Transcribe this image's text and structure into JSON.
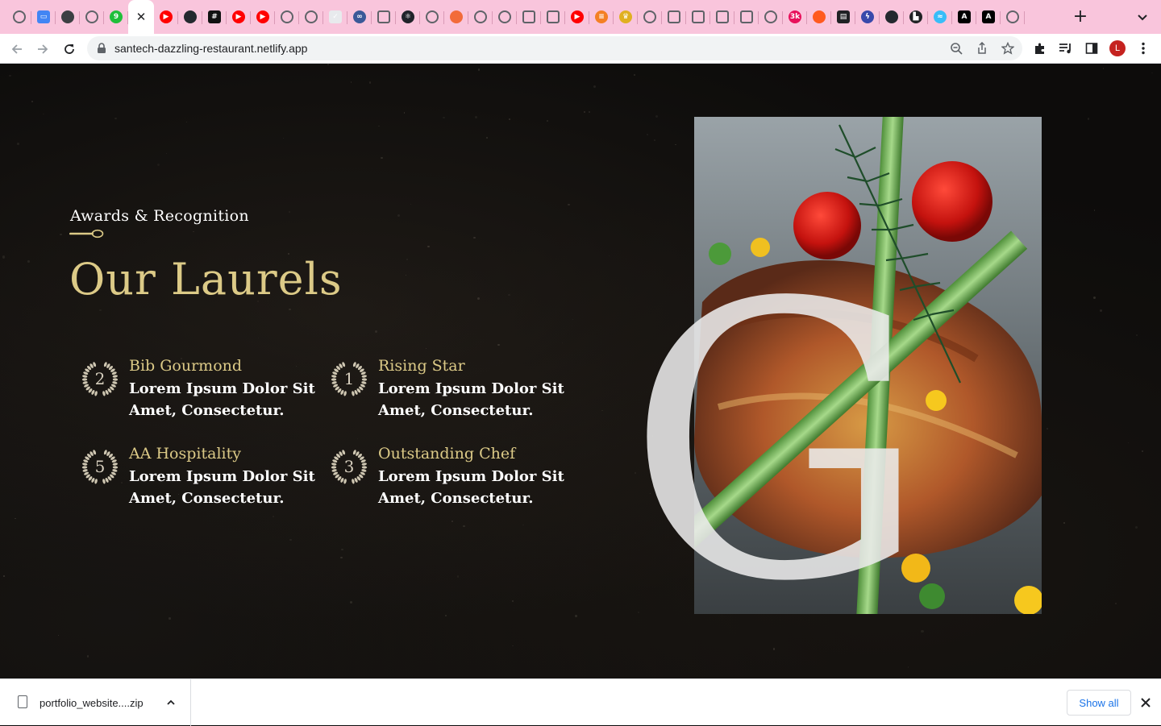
{
  "browser": {
    "tab_favicons": [
      {
        "icon": "globe-icon",
        "color": "#5f6368"
      },
      {
        "icon": "app-icon",
        "color": "#4285f4",
        "glyph": "▭"
      },
      {
        "icon": "dark-circle-icon",
        "color": "#3c4043"
      },
      {
        "icon": "globe-icon",
        "color": "#5f6368"
      },
      {
        "icon": "green-badge-icon",
        "color": "#1fbf3a",
        "glyph": "9"
      },
      {
        "icon": "diamond-icon",
        "color": "#16a3b8"
      },
      {
        "icon": "youtube-icon",
        "color": "#ff0000",
        "glyph": "▶"
      },
      {
        "icon": "github-icon",
        "color": "#24292f"
      },
      {
        "icon": "app-icon",
        "color": "#111111",
        "glyph": "#"
      },
      {
        "icon": "youtube-icon",
        "color": "#ff0000",
        "glyph": "▶"
      },
      {
        "icon": "youtube-icon",
        "color": "#ff0000",
        "glyph": "▶"
      },
      {
        "icon": "globe-icon",
        "color": "#5f6368"
      },
      {
        "icon": "globe-icon",
        "color": "#5f6368"
      },
      {
        "icon": "app-icon",
        "color": "#e8eaed",
        "glyph": "✓"
      },
      {
        "icon": "infinity-icon",
        "color": "#3b5998",
        "glyph": "∞"
      },
      {
        "icon": "square-icon",
        "color": "#5f6368"
      },
      {
        "icon": "react-icon",
        "color": "#20232a",
        "glyph": "⚛"
      },
      {
        "icon": "globe-icon",
        "color": "#5f6368"
      },
      {
        "icon": "octopus-icon",
        "color": "#f26b3a"
      },
      {
        "icon": "globe-icon",
        "color": "#5f6368"
      },
      {
        "icon": "globe-icon",
        "color": "#5f6368"
      },
      {
        "icon": "square-icon",
        "color": "#5f6368"
      },
      {
        "icon": "square-icon",
        "color": "#5f6368"
      },
      {
        "icon": "youtube-icon",
        "color": "#ff0000",
        "glyph": "▶"
      },
      {
        "icon": "stack-icon",
        "color": "#f48024",
        "glyph": "≡"
      },
      {
        "icon": "trophy-icon",
        "color": "#e0b020",
        "glyph": "♛"
      },
      {
        "icon": "globe-icon",
        "color": "#5f6368"
      },
      {
        "icon": "square-icon",
        "color": "#5f6368"
      },
      {
        "icon": "square-icon",
        "color": "#5f6368"
      },
      {
        "icon": "square-icon",
        "color": "#5f6368"
      },
      {
        "icon": "square-icon",
        "color": "#5f6368"
      },
      {
        "icon": "globe-icon",
        "color": "#5f6368"
      },
      {
        "icon": "badge-icon",
        "color": "#e8115b",
        "glyph": "3k"
      },
      {
        "icon": "swirl-icon",
        "color": "#ff5a1f"
      },
      {
        "icon": "news-icon",
        "color": "#202124",
        "glyph": "▤"
      },
      {
        "icon": "bolt-icon",
        "color": "#3949ab",
        "glyph": "ϟ"
      },
      {
        "icon": "github-icon",
        "color": "#24292f"
      },
      {
        "icon": "chart-icon",
        "color": "#202124",
        "glyph": "▙"
      },
      {
        "icon": "wave-icon",
        "color": "#38bdf8",
        "glyph": "≈"
      },
      {
        "icon": "app-icon",
        "color": "#000000",
        "glyph": "A"
      },
      {
        "icon": "app-icon",
        "color": "#000000",
        "glyph": "A"
      },
      {
        "icon": "chrome-icon",
        "color": "#5f6368"
      }
    ],
    "active_tab_index": 5,
    "url": "santech-dazzling-restaurant.netlify.app",
    "avatar_letter": "L"
  },
  "section": {
    "subtitle": "Awards & Recognition",
    "title": "Our Laurels",
    "decorative_letter": "G"
  },
  "awards": [
    {
      "number": "2",
      "title": "Bib Gourmond",
      "desc": "Lorem Ipsum Dolor Sit Amet, Consectetur."
    },
    {
      "number": "1",
      "title": "Rising Star",
      "desc": "Lorem Ipsum Dolor Sit Amet, Consectetur."
    },
    {
      "number": "5",
      "title": "AA Hospitality",
      "desc": "Lorem Ipsum Dolor Sit Amet, Consectetur."
    },
    {
      "number": "3",
      "title": "Outstanding Chef",
      "desc": "Lorem Ipsum Dolor Sit Amet, Consectetur."
    }
  ],
  "downloads": {
    "file_name": "portfolio_website....zip",
    "show_all_label": "Show all"
  },
  "colors": {
    "gold": "#dcca87",
    "tab_strip": "#f9c5dc",
    "background": "#0d0c0b"
  }
}
